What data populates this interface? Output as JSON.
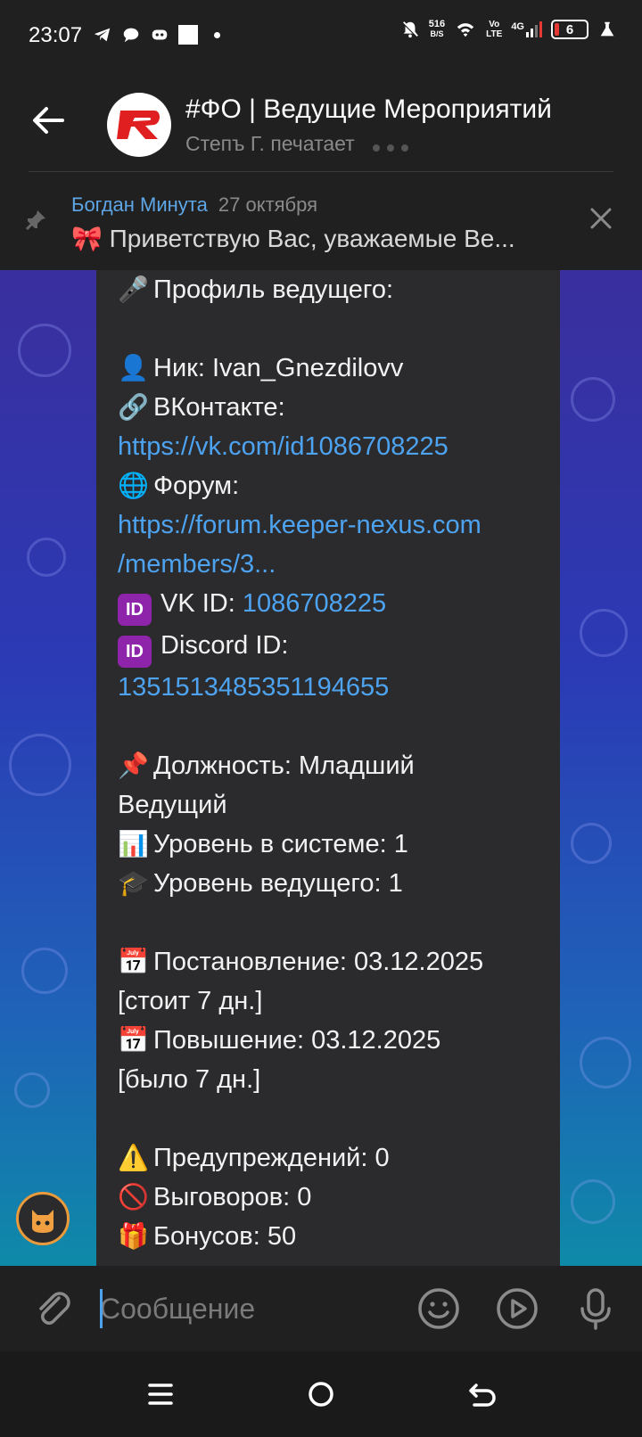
{
  "status_bar": {
    "time": "23:07",
    "speed_value": "516",
    "speed_unit": "B/S",
    "volte_top": "Vo",
    "volte_bottom": "LTE",
    "network": "4G",
    "battery": "6"
  },
  "header": {
    "title": "#ФО | Ведущие Мероприятий",
    "subtitle": "Степъ Г. печатает"
  },
  "pinned": {
    "author": "Богдан Минута",
    "date": "27 октября",
    "emoji": "🎀",
    "text": "Приветствую Вас, уважаемые Ве..."
  },
  "message": {
    "profile_title": "Профиль ведущего:",
    "nick": "Ник: Ivan_Gnezdilovv",
    "vk_label": "ВКонтакте:",
    "vk_link": "https://vk.com/id1086708225",
    "forum_label": "Форум:",
    "forum_link_1": "https://forum.keeper-nexus.com",
    "forum_link_2": "/members/3...",
    "id_badge": "ID",
    "vk_id_label": "VK ID: ",
    "vk_id_value": "1086708225",
    "discord_id_label": "Discord ID:",
    "discord_id_value": "1351513485351194655",
    "position_1": "Должность: Младший",
    "position_2": "Ведущий",
    "system_level": "Уровень в системе: 1",
    "host_level": "Уровень ведущего: 1",
    "appointment_1": "Постановление: 03.12.2025",
    "appointment_2": "[стоит 7 дн.]",
    "promotion_1": "Повышение: 03.12.2025",
    "promotion_2": "[было 7 дн.]",
    "warnings": "Предупреждений: 0",
    "reprimands": "Выговоров: 0",
    "bonuses": "Бонусов: 50"
  },
  "input": {
    "placeholder": "Сообщение"
  },
  "icons": {
    "back": "arrow-left-icon",
    "pin": "pin-icon",
    "close": "close-icon",
    "attach": "paperclip-icon",
    "emoji": "smile-icon",
    "video": "play-circle-icon",
    "mic": "mic-icon"
  },
  "colors": {
    "link": "#4da3f0",
    "author": "#5ea6e6",
    "bubble": "#2b2b2d"
  }
}
